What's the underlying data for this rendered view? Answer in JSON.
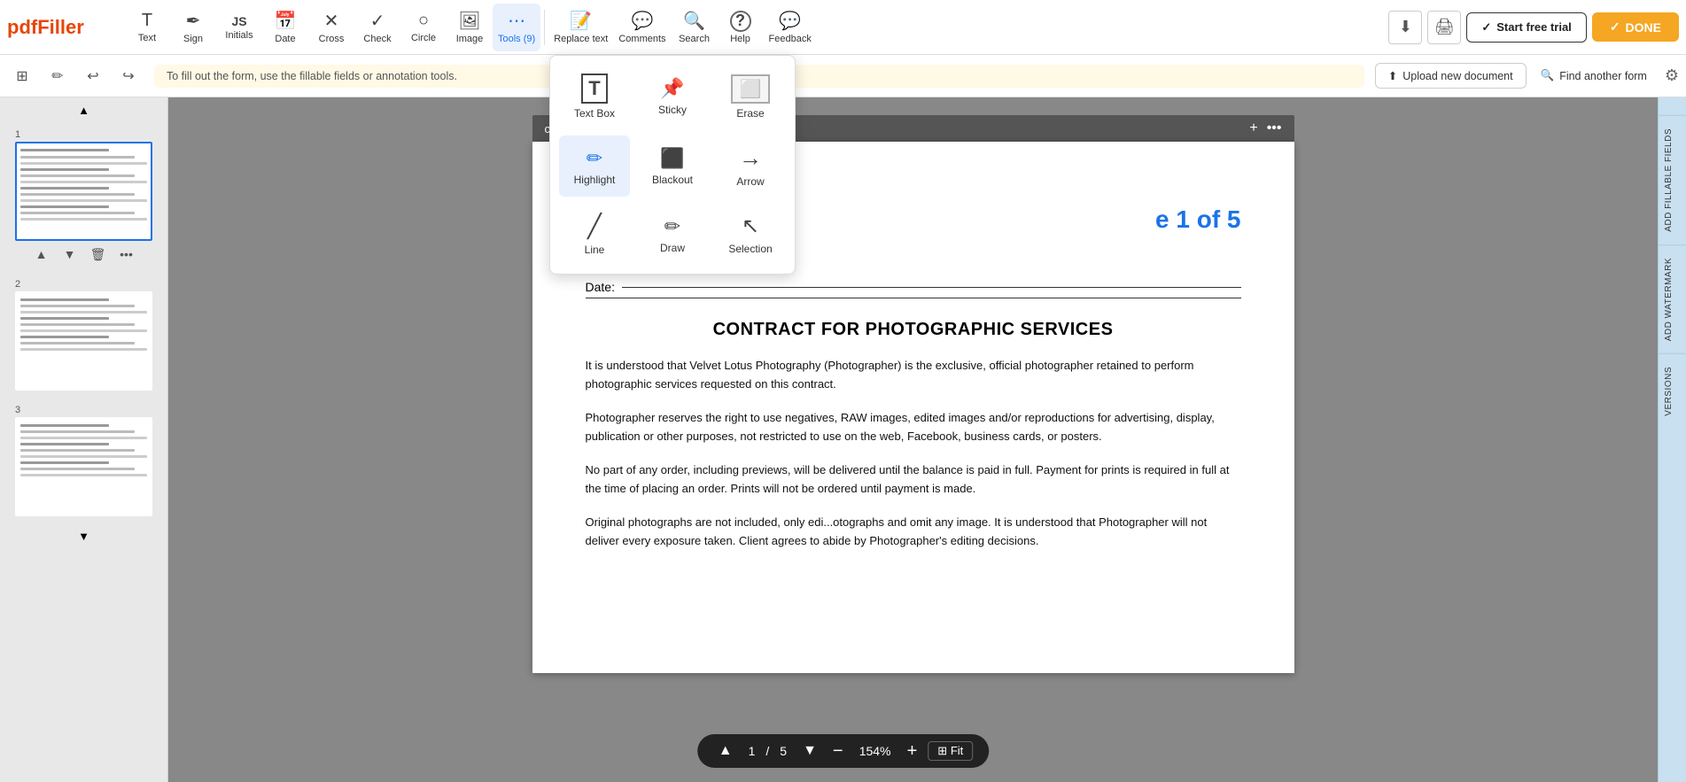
{
  "app": {
    "logo": "pdfFiller",
    "logo_color": "#e8450a"
  },
  "toolbar": {
    "tools": [
      {
        "id": "text",
        "label": "Text",
        "icon": "T"
      },
      {
        "id": "sign",
        "label": "Sign",
        "icon": "✒"
      },
      {
        "id": "initials",
        "label": "Initials",
        "icon": "JS"
      },
      {
        "id": "date",
        "label": "Date",
        "icon": "📅"
      },
      {
        "id": "cross",
        "label": "Cross",
        "icon": "✕"
      },
      {
        "id": "check",
        "label": "Check",
        "icon": "✓"
      },
      {
        "id": "circle",
        "label": "Circle",
        "icon": "○"
      },
      {
        "id": "image",
        "label": "Image",
        "icon": "🖼"
      },
      {
        "id": "tools",
        "label": "Tools (9)",
        "icon": "⋯",
        "active": true
      }
    ],
    "right_tools": [
      {
        "id": "replace-text",
        "label": "Replace text",
        "icon": "📝"
      },
      {
        "id": "comments",
        "label": "Comments",
        "icon": "💬"
      },
      {
        "id": "search",
        "label": "Search",
        "icon": "🔍"
      },
      {
        "id": "help",
        "label": "Help",
        "icon": "?"
      },
      {
        "id": "feedback",
        "label": "Feedback",
        "icon": "💬"
      }
    ],
    "download_label": "⬇",
    "print_label": "🖨",
    "trial_label": "Start free trial",
    "done_label": "DONE"
  },
  "second_toolbar": {
    "info_text": "To fill out the form, use the fillable fields or annotation tools.",
    "upload_label": "Upload new document",
    "find_form_label": "Find another form"
  },
  "document": {
    "title": "contract.pdf",
    "page_indicator": "e 1 of 5",
    "date_label": "Date:",
    "contract_title": "CONTRACT FOR PHOTOGRAPHIC SERVICES",
    "paragraphs": [
      "It is understood that Velvet Lotus Photography (Photographer) is the exclusive, official photographer retained to perform photographic services requested on this contract.",
      "Photographer reserves the right to use negatives, RAW images, edited images and/or reproductions for advertising, display, publication or other purposes, not restricted to use on the web, Facebook, business cards, or posters.",
      "No part of any order, including previews, will be delivered until the balance is paid in full. Payment for prints is required in full at the time of placing an order. Prints will not be ordered until payment is made.",
      "Original photographs are not included, only edi...otographs and omit any image. It is understood that Photographer will not deliver every exposure taken. Client agrees to abide by Photographer's editing decisions."
    ]
  },
  "dropdown": {
    "items": [
      {
        "id": "text-box",
        "label": "Text Box",
        "icon": "T"
      },
      {
        "id": "sticky",
        "label": "Sticky",
        "icon": "📌"
      },
      {
        "id": "erase",
        "label": "Erase",
        "icon": "⬜"
      },
      {
        "id": "highlight",
        "label": "Highlight",
        "icon": "✏"
      },
      {
        "id": "blackout",
        "label": "Blackout",
        "icon": "⬛"
      },
      {
        "id": "arrow",
        "label": "Arrow",
        "icon": "→"
      },
      {
        "id": "line",
        "label": "Line",
        "icon": "╱"
      },
      {
        "id": "draw",
        "label": "Draw",
        "icon": "✏"
      },
      {
        "id": "selection",
        "label": "Selection",
        "icon": "↖"
      }
    ]
  },
  "page_thumbnails": [
    {
      "number": "1",
      "active": true
    },
    {
      "number": "2",
      "active": false
    },
    {
      "number": "3",
      "active": false
    }
  ],
  "bottom_bar": {
    "current_page": "1",
    "total_pages": "5",
    "zoom_level": "154%",
    "fit_label": "Fit"
  },
  "right_tabs": [
    "ADD FILLABLE FIELDS",
    "ADD WATERMARK",
    "VERSIONS"
  ]
}
